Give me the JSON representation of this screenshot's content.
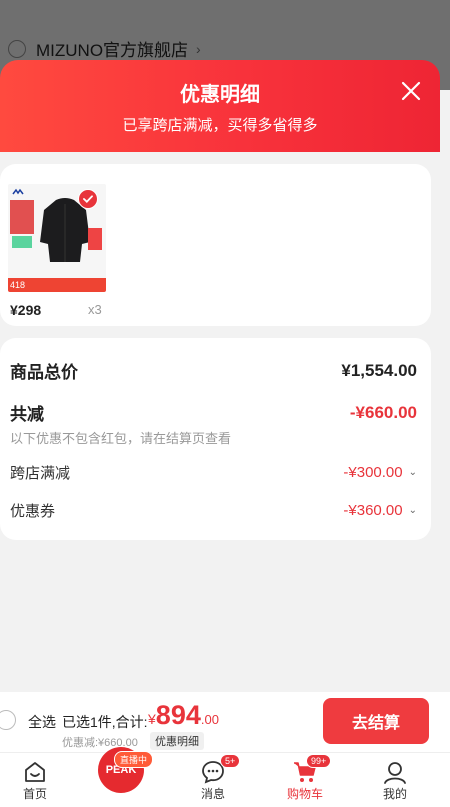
{
  "background_store": {
    "name": "MIZUNO官方旗舰店",
    "chevron_icon": "chevron-right-icon"
  },
  "sheet": {
    "title": "优惠明细",
    "subtitle": "已享跨店满减，买得多省得多",
    "close_icon": "close-icon",
    "accent_color": "#f8323b"
  },
  "product": {
    "thumb_price": "418",
    "price": "¥298",
    "quantity": "x3",
    "checked": true
  },
  "summary": {
    "total_label": "商品总价",
    "total_value": "¥1,554.00",
    "discount_label": "共减",
    "discount_value": "-¥660.00",
    "hint": "以下优惠不包含红包，请在结算页查看",
    "items": [
      {
        "label": "跨店满减",
        "value": "-¥300.00"
      },
      {
        "label": "优惠券",
        "value": "-¥360.00"
      }
    ]
  },
  "checkout": {
    "select_all": "全选",
    "selected": "已选1件,合计:",
    "currency": "¥",
    "total_int": "894",
    "total_dec": ".00",
    "discount": "优惠减:¥660.00",
    "detail_link": "优惠明细",
    "pay_button": "去结算"
  },
  "tabbar": {
    "home": "首页",
    "live_badge": "直播中",
    "peak_label": "PEAK",
    "messages": "消息",
    "messages_badge": "5+",
    "cart": "购物车",
    "cart_badge": "99+",
    "mine": "我的"
  }
}
